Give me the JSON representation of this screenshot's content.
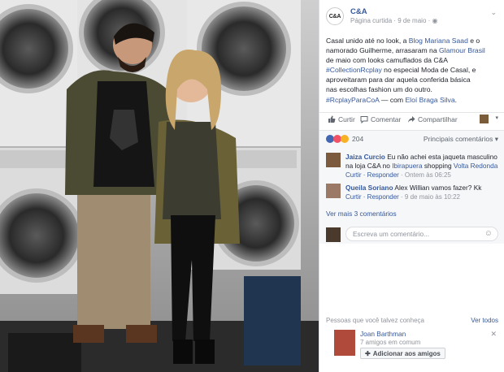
{
  "page": {
    "avatar_text": "C&A",
    "name": "C&A",
    "meta": "Página curtida · 9 de maio ·"
  },
  "post": {
    "line1": "Casal unido até no look, a ",
    "link1": "Blog Mariana Saad",
    "line1b": " e o",
    "line2a": "namorado Guilherme, arrasaram na ",
    "link2": "Glamour Brasil",
    "line3": "de maio com looks camuflados da C&A",
    "tag1": "#CollectionRcplay",
    "line4b": " no especial Moda de Casal, e",
    "line5": "aproveitaram para dar aquela conferida básica",
    "line6": "nas escolhas fashion um do outro.",
    "tag2": "#RcplayParaCoA",
    "with_text": " — com ",
    "with_name": "Eloí Braga Silva",
    "end": "."
  },
  "actions": {
    "like": "Curtir",
    "comment": "Comentar",
    "share": "Compartilhar"
  },
  "stats": {
    "likes": "204",
    "sort_label": "Principais comentários ▾"
  },
  "comments": [
    {
      "author": "Jaiza Curcio",
      "text": " Eu não achei esta jaqueta masculino na loja C&A no ",
      "text_link": "Ibirapuera",
      "text2": " shopping ",
      "text_link2": "Volta Redonda",
      "reply": "Curtir · Responder",
      "time": " · Ontem às 06:25"
    },
    {
      "author": "Queila Soriano",
      "text": " Alex Willian vamos fazer? Kk",
      "reply": "Curtir · Responder",
      "time": " · 9 de maio às 10:22"
    }
  ],
  "more_comments": "Ver mais 3 comentários",
  "compose_placeholder": "Escreva um comentário...",
  "pymk": {
    "heading": "Pessoas que você talvez conheça",
    "see_all": "Ver todos",
    "name": "Joan Barthman",
    "mutual": "7 amigos em comum",
    "add_label": "Adicionar aos amigos"
  },
  "colors": {
    "link": "#365899",
    "muted": "#90949c",
    "like_blue": "#4267b2",
    "love_red": "#f25268"
  }
}
